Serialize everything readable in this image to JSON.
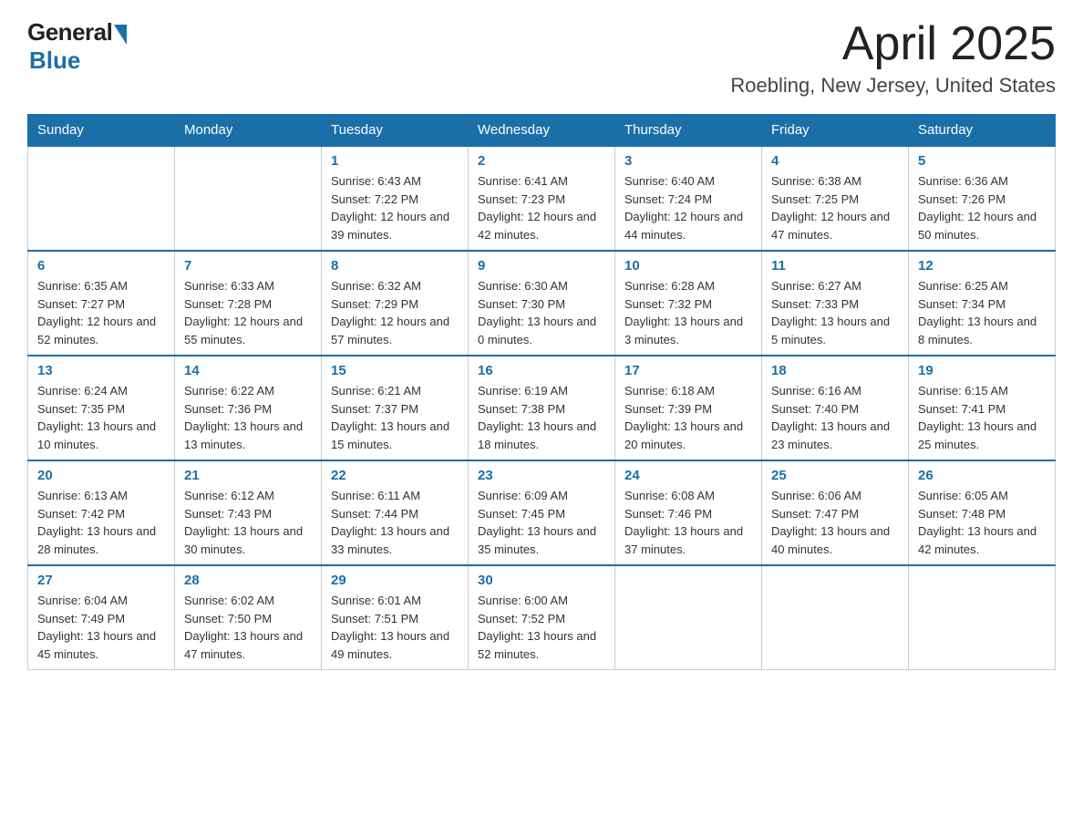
{
  "logo": {
    "general": "General",
    "blue": "Blue"
  },
  "title": "April 2025",
  "location": "Roebling, New Jersey, United States",
  "days_of_week": [
    "Sunday",
    "Monday",
    "Tuesday",
    "Wednesday",
    "Thursday",
    "Friday",
    "Saturday"
  ],
  "weeks": [
    [
      {
        "day": "",
        "sunrise": "",
        "sunset": "",
        "daylight": ""
      },
      {
        "day": "",
        "sunrise": "",
        "sunset": "",
        "daylight": ""
      },
      {
        "day": "1",
        "sunrise": "Sunrise: 6:43 AM",
        "sunset": "Sunset: 7:22 PM",
        "daylight": "Daylight: 12 hours and 39 minutes."
      },
      {
        "day": "2",
        "sunrise": "Sunrise: 6:41 AM",
        "sunset": "Sunset: 7:23 PM",
        "daylight": "Daylight: 12 hours and 42 minutes."
      },
      {
        "day": "3",
        "sunrise": "Sunrise: 6:40 AM",
        "sunset": "Sunset: 7:24 PM",
        "daylight": "Daylight: 12 hours and 44 minutes."
      },
      {
        "day": "4",
        "sunrise": "Sunrise: 6:38 AM",
        "sunset": "Sunset: 7:25 PM",
        "daylight": "Daylight: 12 hours and 47 minutes."
      },
      {
        "day": "5",
        "sunrise": "Sunrise: 6:36 AM",
        "sunset": "Sunset: 7:26 PM",
        "daylight": "Daylight: 12 hours and 50 minutes."
      }
    ],
    [
      {
        "day": "6",
        "sunrise": "Sunrise: 6:35 AM",
        "sunset": "Sunset: 7:27 PM",
        "daylight": "Daylight: 12 hours and 52 minutes."
      },
      {
        "day": "7",
        "sunrise": "Sunrise: 6:33 AM",
        "sunset": "Sunset: 7:28 PM",
        "daylight": "Daylight: 12 hours and 55 minutes."
      },
      {
        "day": "8",
        "sunrise": "Sunrise: 6:32 AM",
        "sunset": "Sunset: 7:29 PM",
        "daylight": "Daylight: 12 hours and 57 minutes."
      },
      {
        "day": "9",
        "sunrise": "Sunrise: 6:30 AM",
        "sunset": "Sunset: 7:30 PM",
        "daylight": "Daylight: 13 hours and 0 minutes."
      },
      {
        "day": "10",
        "sunrise": "Sunrise: 6:28 AM",
        "sunset": "Sunset: 7:32 PM",
        "daylight": "Daylight: 13 hours and 3 minutes."
      },
      {
        "day": "11",
        "sunrise": "Sunrise: 6:27 AM",
        "sunset": "Sunset: 7:33 PM",
        "daylight": "Daylight: 13 hours and 5 minutes."
      },
      {
        "day": "12",
        "sunrise": "Sunrise: 6:25 AM",
        "sunset": "Sunset: 7:34 PM",
        "daylight": "Daylight: 13 hours and 8 minutes."
      }
    ],
    [
      {
        "day": "13",
        "sunrise": "Sunrise: 6:24 AM",
        "sunset": "Sunset: 7:35 PM",
        "daylight": "Daylight: 13 hours and 10 minutes."
      },
      {
        "day": "14",
        "sunrise": "Sunrise: 6:22 AM",
        "sunset": "Sunset: 7:36 PM",
        "daylight": "Daylight: 13 hours and 13 minutes."
      },
      {
        "day": "15",
        "sunrise": "Sunrise: 6:21 AM",
        "sunset": "Sunset: 7:37 PM",
        "daylight": "Daylight: 13 hours and 15 minutes."
      },
      {
        "day": "16",
        "sunrise": "Sunrise: 6:19 AM",
        "sunset": "Sunset: 7:38 PM",
        "daylight": "Daylight: 13 hours and 18 minutes."
      },
      {
        "day": "17",
        "sunrise": "Sunrise: 6:18 AM",
        "sunset": "Sunset: 7:39 PM",
        "daylight": "Daylight: 13 hours and 20 minutes."
      },
      {
        "day": "18",
        "sunrise": "Sunrise: 6:16 AM",
        "sunset": "Sunset: 7:40 PM",
        "daylight": "Daylight: 13 hours and 23 minutes."
      },
      {
        "day": "19",
        "sunrise": "Sunrise: 6:15 AM",
        "sunset": "Sunset: 7:41 PM",
        "daylight": "Daylight: 13 hours and 25 minutes."
      }
    ],
    [
      {
        "day": "20",
        "sunrise": "Sunrise: 6:13 AM",
        "sunset": "Sunset: 7:42 PM",
        "daylight": "Daylight: 13 hours and 28 minutes."
      },
      {
        "day": "21",
        "sunrise": "Sunrise: 6:12 AM",
        "sunset": "Sunset: 7:43 PM",
        "daylight": "Daylight: 13 hours and 30 minutes."
      },
      {
        "day": "22",
        "sunrise": "Sunrise: 6:11 AM",
        "sunset": "Sunset: 7:44 PM",
        "daylight": "Daylight: 13 hours and 33 minutes."
      },
      {
        "day": "23",
        "sunrise": "Sunrise: 6:09 AM",
        "sunset": "Sunset: 7:45 PM",
        "daylight": "Daylight: 13 hours and 35 minutes."
      },
      {
        "day": "24",
        "sunrise": "Sunrise: 6:08 AM",
        "sunset": "Sunset: 7:46 PM",
        "daylight": "Daylight: 13 hours and 37 minutes."
      },
      {
        "day": "25",
        "sunrise": "Sunrise: 6:06 AM",
        "sunset": "Sunset: 7:47 PM",
        "daylight": "Daylight: 13 hours and 40 minutes."
      },
      {
        "day": "26",
        "sunrise": "Sunrise: 6:05 AM",
        "sunset": "Sunset: 7:48 PM",
        "daylight": "Daylight: 13 hours and 42 minutes."
      }
    ],
    [
      {
        "day": "27",
        "sunrise": "Sunrise: 6:04 AM",
        "sunset": "Sunset: 7:49 PM",
        "daylight": "Daylight: 13 hours and 45 minutes."
      },
      {
        "day": "28",
        "sunrise": "Sunrise: 6:02 AM",
        "sunset": "Sunset: 7:50 PM",
        "daylight": "Daylight: 13 hours and 47 minutes."
      },
      {
        "day": "29",
        "sunrise": "Sunrise: 6:01 AM",
        "sunset": "Sunset: 7:51 PM",
        "daylight": "Daylight: 13 hours and 49 minutes."
      },
      {
        "day": "30",
        "sunrise": "Sunrise: 6:00 AM",
        "sunset": "Sunset: 7:52 PM",
        "daylight": "Daylight: 13 hours and 52 minutes."
      },
      {
        "day": "",
        "sunrise": "",
        "sunset": "",
        "daylight": ""
      },
      {
        "day": "",
        "sunrise": "",
        "sunset": "",
        "daylight": ""
      },
      {
        "day": "",
        "sunrise": "",
        "sunset": "",
        "daylight": ""
      }
    ]
  ]
}
